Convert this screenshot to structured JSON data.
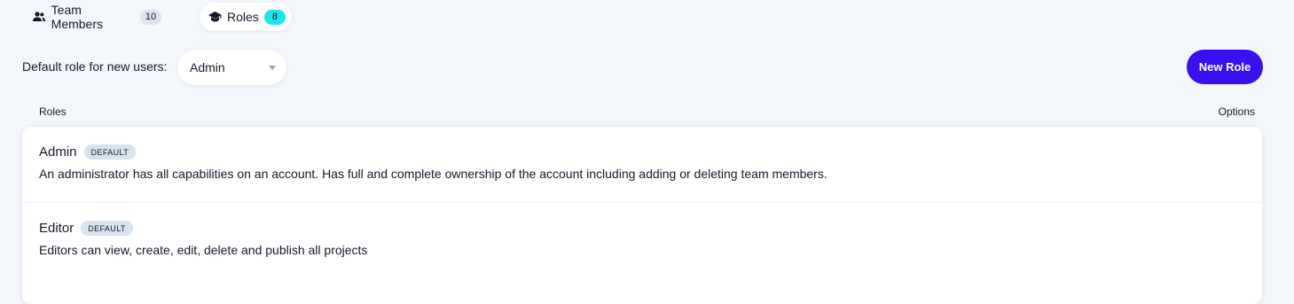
{
  "tabs": [
    {
      "label": "Team Members",
      "count": "10",
      "icon": "users-icon"
    },
    {
      "label": "Roles",
      "count": "8",
      "icon": "graduation-cap-icon"
    }
  ],
  "default_role": {
    "label": "Default role for new users:",
    "value": "Admin"
  },
  "new_role_button": "New Role",
  "columns": {
    "roles": "Roles",
    "options": "Options"
  },
  "roles": [
    {
      "name": "Admin",
      "badge": "DEFAULT",
      "description": "An administrator has all capabilities on an account. Has full and complete ownership of the account including adding or deleting team members."
    },
    {
      "name": "Editor",
      "badge": "DEFAULT",
      "description": "Editors can view, create, edit, delete and publish all projects"
    }
  ],
  "colors": {
    "accent": "#3a0ff0",
    "roles_count_bg": "#19e6ec",
    "background": "#f3f6fa"
  }
}
